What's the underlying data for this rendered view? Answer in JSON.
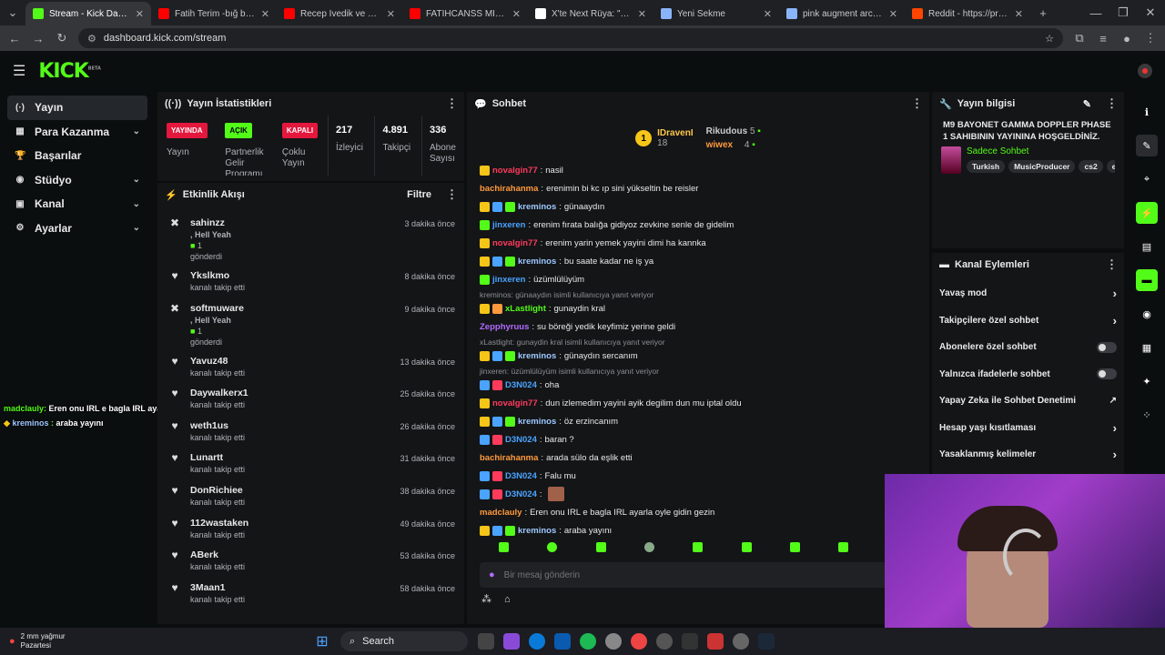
{
  "browser": {
    "tabs": [
      {
        "title": "Stream - Kick Dashboard",
        "color": "#53fc18",
        "active": true
      },
      {
        "title": "Fatih Terim -bığ bu - YouT",
        "color": "#ff0000"
      },
      {
        "title": "Recep İvedik ve Fatih Ter",
        "color": "#ff0000"
      },
      {
        "title": "FATİHCANSS MİZAH - JET",
        "color": "#ff0000"
      },
      {
        "title": "X'te Next Rüya: \"Valorant",
        "color": "#ffffff"
      },
      {
        "title": "Yeni Sekme",
        "color": "#8ab4f8"
      },
      {
        "title": "pink augment arc raiders",
        "color": "#8ab4f8"
      },
      {
        "title": "Reddit - https://preview.re",
        "color": "#ff4500"
      }
    ],
    "url": "dashboard.kick.com/stream"
  },
  "kick": {
    "logo": "KICK",
    "beta": "BETA"
  },
  "sidebar": {
    "items": [
      {
        "label": "Yayın",
        "icon": "(·)",
        "chev": ""
      },
      {
        "label": "Para Kazanma",
        "icon": "▦",
        "chev": "⌄"
      },
      {
        "label": "Başarılar",
        "icon": "🏆",
        "chev": ""
      },
      {
        "label": "Stüdyo",
        "icon": "◉",
        "chev": "⌄"
      },
      {
        "label": "Kanal",
        "icon": "▣",
        "chev": "⌄"
      },
      {
        "label": "Ayarlar",
        "icon": "⚙",
        "chev": "⌄"
      }
    ]
  },
  "stats": {
    "title": "Yayın İstatistikleri",
    "live_badge": "YAYINDA",
    "live_label": "Yayın",
    "partner_badge": "AÇIK",
    "partner_label": "Partnerlik Gelir Programı",
    "multi_badge": "KAPALI",
    "multi_label": "Çoklu Yayın",
    "viewers": "217",
    "viewers_label": "İzleyici",
    "followers": "4.891",
    "followers_label": "Takipçi",
    "subs": "336",
    "subs_label": "Abone Sayısı"
  },
  "activity": {
    "title": "Etkinlik Akışı",
    "filter": "Filtre",
    "items": [
      {
        "name": "sahinzz",
        "extra": ", Hell Yeah",
        "count": "1",
        "sub": "gönderdi",
        "time": "3 dakika önce",
        "type": "gift"
      },
      {
        "name": "Ykslkmo",
        "sub": "kanalı takip etti",
        "time": "8 dakika önce",
        "type": "follow"
      },
      {
        "name": "softmuware",
        "extra": ", Hell Yeah",
        "count": "1",
        "sub": "gönderdi",
        "time": "9 dakika önce",
        "type": "gift"
      },
      {
        "name": "Yavuz48",
        "sub": "kanalı takip etti",
        "time": "13 dakika önce",
        "type": "follow"
      },
      {
        "name": "Daywalkerx1",
        "sub": "kanalı takip etti",
        "time": "25 dakika önce",
        "type": "follow"
      },
      {
        "name": "weth1us",
        "sub": "kanalı takip etti",
        "time": "26 dakika önce",
        "type": "follow"
      },
      {
        "name": "Lunartt",
        "sub": "kanalı takip etti",
        "time": "31 dakika önce",
        "type": "follow"
      },
      {
        "name": "DonRichiee",
        "sub": "kanalı takip etti",
        "time": "38 dakika önce",
        "type": "follow"
      },
      {
        "name": "112wastaken",
        "sub": "kanalı takip etti",
        "time": "49 dakika önce",
        "type": "follow"
      },
      {
        "name": "ABerk",
        "sub": "kanalı takip etti",
        "time": "53 dakika önce",
        "type": "follow"
      },
      {
        "name": "3Maan1",
        "sub": "kanalı takip etti",
        "time": "58 dakika önce",
        "type": "follow"
      }
    ]
  },
  "chat": {
    "title": "Sohbet",
    "top": [
      {
        "rank": "1",
        "name": "IDravenI",
        "count": "18"
      },
      {
        "name": "Rikudous",
        "count": "5"
      },
      {
        "name": "wiwex",
        "count": "4"
      }
    ],
    "lines": [
      {
        "user": "novalgin77",
        "color": "#ff3b5c",
        "msg": "nasil",
        "badges": [
          "#f5c518"
        ]
      },
      {
        "user": "bachirahanma",
        "color": "#ff9a3c",
        "msg": "erenimin bi kc ıp sini yükseltin be reisler",
        "badges": []
      },
      {
        "user": "kreminos",
        "color": "#9ec8ff",
        "msg": "günaaydın",
        "badges": [
          "#f5c518",
          "#4aa3ff",
          "#53fc18"
        ]
      },
      {
        "user": "jinxeren",
        "color": "#4aa3ff",
        "msg": "erenim fırata balığa gidiyoz zevkine senle de gidelim",
        "badges": [
          "#53fc18"
        ]
      },
      {
        "user": "novalgin77",
        "color": "#ff3b5c",
        "msg": "erenim yarin yemek yayini dimi ha kannka",
        "badges": [
          "#f5c518"
        ]
      },
      {
        "user": "kreminos",
        "color": "#9ec8ff",
        "msg": "bu saate kadar ne iş ya",
        "badges": [
          "#f5c518",
          "#4aa3ff",
          "#53fc18"
        ]
      },
      {
        "user": "jinxeren",
        "color": "#4aa3ff",
        "msg": "üzümlülüyüm",
        "badges": [
          "#53fc18"
        ]
      },
      {
        "reply": "kreminos: günaaydın isimli kullanıcıya yanıt veriyor",
        "user": "xLastlight",
        "color": "#53fc18",
        "msg": "gunaydin kral",
        "badges": [
          "#f5c518",
          "#ff9a3c"
        ]
      },
      {
        "user": "Zepphyruus",
        "color": "#b26bff",
        "msg": "su böreği yedik keyfimiz yerine geldi",
        "badges": []
      },
      {
        "reply": "xLastlight: gunaydin kral isimli kullanıcıya yanıt veriyor",
        "user": "kreminos",
        "color": "#9ec8ff",
        "msg": "günaydın sercanım",
        "badges": [
          "#f5c518",
          "#4aa3ff",
          "#53fc18"
        ]
      },
      {
        "reply": "jinxeren: üzümlülüyüm isimli kullanıcıya yanıt veriyor",
        "user": "D3N024",
        "color": "#4aa3ff",
        "msg": "oha",
        "badges": [
          "#4aa3ff",
          "#ff3b5c"
        ]
      },
      {
        "user": "novalgin77",
        "color": "#ff3b5c",
        "msg": "dun izlemedim yayini ayik degilim dun mu iptal oldu",
        "badges": [
          "#f5c518"
        ]
      },
      {
        "user": "kreminos",
        "color": "#9ec8ff",
        "msg": "öz erzincanım",
        "badges": [
          "#f5c518",
          "#4aa3ff",
          "#53fc18"
        ]
      },
      {
        "user": "D3N024",
        "color": "#4aa3ff",
        "msg": "baran ?",
        "badges": [
          "#4aa3ff",
          "#ff3b5c"
        ]
      },
      {
        "user": "bachirahanma",
        "color": "#ff9a3c",
        "msg": "arada sülo da eşlik etti",
        "badges": []
      },
      {
        "user": "D3N024",
        "color": "#4aa3ff",
        "msg": "Falu mu",
        "badges": [
          "#4aa3ff",
          "#ff3b5c"
        ]
      },
      {
        "user": "D3N024",
        "color": "#4aa3ff",
        "msg": "",
        "badges": [
          "#4aa3ff",
          "#ff3b5c"
        ]
      },
      {
        "user": "madclauly",
        "color": "#ff9a3c",
        "msg": "Eren onu IRL e bagla IRL ayarla oyle gidin gezin",
        "badges": []
      },
      {
        "user": "kreminos",
        "color": "#9ec8ff",
        "msg": "araba yayını",
        "badges": [
          "#f5c518",
          "#4aa3ff",
          "#53fc18"
        ]
      }
    ],
    "placeholder": "Bir mesaj gönderin"
  },
  "info": {
    "title": "Yayın bilgisi",
    "stream_title": "M9 BAYONET GAMMA DOPPLER PHASE 1 SAHIBININ YAYININA HOŞGELDİNİZ.",
    "category": "Sadece Sohbet",
    "tags": [
      "Turkish",
      "MusicProducer",
      "cs2",
      "e"
    ]
  },
  "actions": {
    "title": "Kanal Eylemleri",
    "items": [
      {
        "label": "Yavaş mod",
        "kind": "chevron"
      },
      {
        "label": "Takipçilere özel sohbet",
        "kind": "chevron"
      },
      {
        "label": "Abonelere özel sohbet",
        "kind": "toggle"
      },
      {
        "label": "Yalnızca ifadelerle sohbet",
        "kind": "toggle"
      },
      {
        "label": "Yapay Zeka ile Sohbet Denetimi",
        "kind": "external"
      },
      {
        "label": "Hesap yaşı kısıtlaması",
        "kind": "chevron"
      },
      {
        "label": "Yasaklanmış kelimeler",
        "kind": "chevron"
      }
    ]
  },
  "overlay": {
    "line1_user": "madclauly",
    "line1_msg": "Eren onu IRL e bagla IRL ayarla oyle gidin gezin",
    "line2_user": "kreminos",
    "line2_msg": "araba yayını"
  },
  "taskbar": {
    "weather": "2 mm yağmur",
    "day": "Pazartesi",
    "search": "Search"
  }
}
